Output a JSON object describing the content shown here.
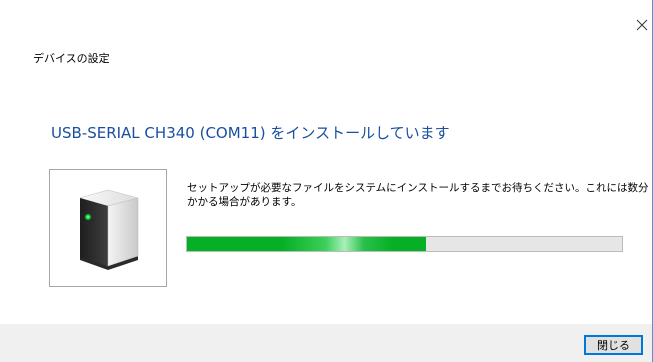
{
  "window": {
    "header_title": "デバイスの設定"
  },
  "main": {
    "heading": "USB-SERIAL CH340 (COM11) をインストールしています",
    "description_line1": "セットアップが必要なファイルをシステムにインストールするまでお待ちください。これには数分",
    "description_line2": "かかる場合があります。",
    "progress_fraction": 0.55,
    "progress_color": "#06b025",
    "device_icon": "usb-drive-icon"
  },
  "footer": {
    "close_label": "閉じる"
  }
}
